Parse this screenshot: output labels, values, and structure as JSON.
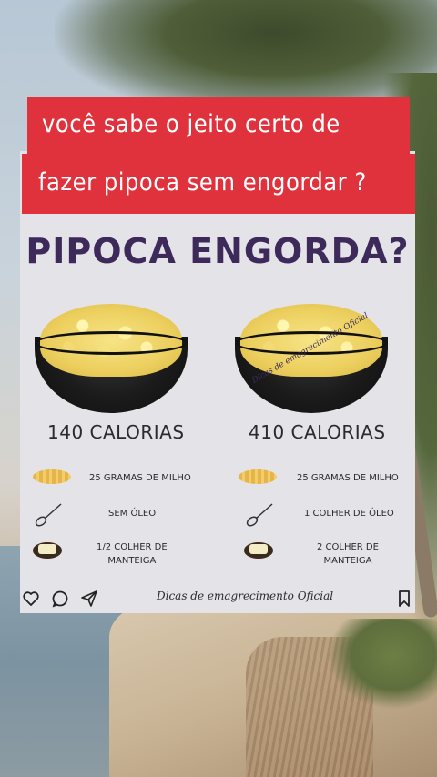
{
  "banner": {
    "line1": "você sabe o jeito certo de",
    "line2": "fazer pipoca sem engordar ?"
  },
  "headline": "PIPOCA ENGORDA?",
  "left": {
    "calories": "140 CALORIAS",
    "corn": "25 GRAMAS DE MILHO",
    "oil": "SEM ÓLEO",
    "butter_line1": "1/2 COLHER DE",
    "butter_line2": "MANTEIGA"
  },
  "right": {
    "calories": "410 CALORIAS",
    "corn": "25 GRAMAS DE MILHO",
    "oil": "1 COLHER DE ÓLEO",
    "butter_line1": "2 COLHER DE",
    "butter_line2": "MANTEIGA"
  },
  "watermark": "Dicas de emagrecimento Oficial",
  "footer": {
    "credit": "Dicas de emagrecimento Oficial",
    "icons": [
      "heart-icon",
      "comment-icon",
      "share-icon",
      "bookmark-icon"
    ]
  },
  "colors": {
    "banner": "#e0323c",
    "headline": "#3d2a5a",
    "card": "#e4e3e8"
  }
}
